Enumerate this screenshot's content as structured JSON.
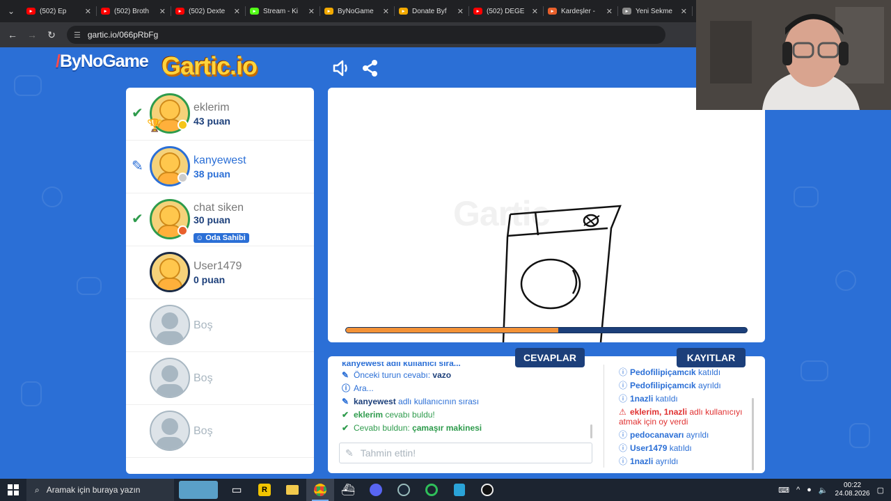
{
  "browser": {
    "tabs": [
      {
        "title": "(502) Ep",
        "fav": "youtube-icon",
        "color": "#ff0000"
      },
      {
        "title": "(502) Broth",
        "fav": "youtube-icon",
        "color": "#ff0000"
      },
      {
        "title": "(502) Dexte",
        "fav": "youtube-icon",
        "color": "#ff0000"
      },
      {
        "title": "Stream - Ki",
        "fav": "kick-icon",
        "color": "#53fc18"
      },
      {
        "title": "ByNoGame",
        "fav": "bynogame-icon",
        "color": "#f2a900"
      },
      {
        "title": "Donate Byf",
        "fav": "bynogame-icon",
        "color": "#f2a900"
      },
      {
        "title": "(502) DEĞE",
        "fav": "youtube-icon",
        "color": "#ff0000"
      },
      {
        "title": "Kardeşler -",
        "fav": "fox-icon",
        "color": "#e8602c"
      },
      {
        "title": "Yeni Sekme",
        "fav": "chrome-icon",
        "color": "#888888"
      }
    ],
    "url": "gartic.io/066pRbFg"
  },
  "header": {
    "brand": "ByNoGame",
    "logo": "Gartic.io"
  },
  "players": [
    {
      "name": "eklerim",
      "points": "43 puan",
      "status": "correct",
      "dot": "#f5c518",
      "trophy": true
    },
    {
      "name": "kanyewest",
      "points": "38 puan",
      "status": "drawing",
      "dot": "#cccccc"
    },
    {
      "name": "chat siken",
      "points": "30 puan",
      "status": "correct",
      "dot": "#e8602c",
      "badge": "Oda Sahibi"
    },
    {
      "name": "User1479",
      "points": "0 puan",
      "status": "none"
    },
    {
      "name": "Boş",
      "empty": true
    },
    {
      "name": "Boş",
      "empty": true
    },
    {
      "name": "Boş",
      "empty": true
    }
  ],
  "canvas": {
    "watermark": "Gartic",
    "timer_progress": 0.53
  },
  "answers": {
    "tab_label": "CEVAPLAR",
    "cut_line": "kanyewest adlı kullanıcı sıra...",
    "messages": [
      {
        "icon": "pencil-icon",
        "pre": "Önceki turun cevabı: ",
        "bold": "vazo",
        "post": ""
      },
      {
        "icon": "info-icon",
        "pre": "Ara...",
        "bold": "",
        "post": ""
      },
      {
        "icon": "pencil-icon",
        "pre": "",
        "bold": "kanyewest",
        "post": " adlı kullanıcının sırası"
      },
      {
        "icon": "check-icon",
        "pre": "",
        "bold": "eklerim",
        "post": " cevabı buldu!",
        "green": true
      },
      {
        "icon": "check-icon",
        "pre": "Cevabı buldun: ",
        "bold": "çamaşır makinesi",
        "post": "",
        "green": true
      }
    ],
    "input_placeholder": "Tahmin ettin!"
  },
  "logs": {
    "tab_label": "KAYITLAR",
    "entries": [
      {
        "bold": "Pedofilipiçamcık",
        "text": " katıldı"
      },
      {
        "bold": "Pedofilipiçamcık",
        "text": " ayrıldı"
      },
      {
        "bold": "1nazli",
        "text": " katıldı"
      },
      {
        "bold": "eklerim, 1nazli",
        "text": " adlı kullanıcıyı atmak için oy verdi",
        "red": true
      },
      {
        "bold": "pedocanavarı",
        "text": " ayrıldı"
      },
      {
        "bold": "User1479",
        "text": " katıldı"
      },
      {
        "bold": "1nazli",
        "text": " ayrıldı"
      }
    ]
  },
  "taskbar": {
    "search_placeholder": "Aramak için buraya yazın",
    "time": "00:22",
    "date": "24.08.2026"
  }
}
